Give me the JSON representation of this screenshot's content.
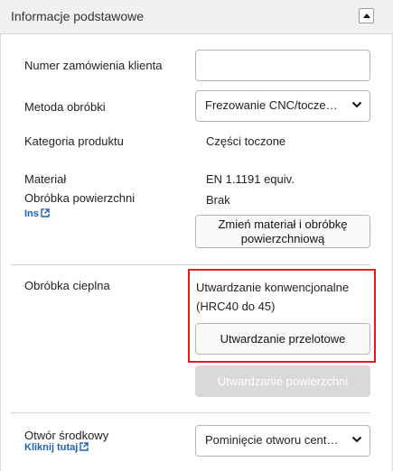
{
  "header": {
    "title": "Informacje podstawowe"
  },
  "fields": {
    "order_number": {
      "label": "Numer zamówienia klienta",
      "value": ""
    },
    "method": {
      "label": "Metoda obróbki",
      "selected": "Frezowanie CNC/toczenie"
    },
    "category": {
      "label": "Kategoria produktu",
      "value": "Części toczone"
    },
    "material": {
      "label": "Materiał",
      "value": "EN 1.1191 equiv."
    },
    "surface": {
      "label": "Obróbka powierzchni",
      "value": "Brak",
      "link": "Ins"
    },
    "change_button": {
      "line1": "Zmień materiał i obróbkę",
      "line2": "powierzchniową"
    },
    "heat": {
      "label": "Obróbka cieplna",
      "desc_line1": "Utwardzanie konwencjonalne",
      "desc_line2": "(HRC40 do 45)",
      "through_button": "Utwardzanie przelotowe",
      "surface_button": "Utwardzanie powierzchni"
    },
    "center_hole": {
      "label": "Otwór środkowy",
      "link": "Kliknij tutaj",
      "selected": "Pominięcie otworu centralnego"
    }
  },
  "colors": {
    "link": "#1d5fb5",
    "highlight": "#e31b1b",
    "disabled_button": "#d9d9d9"
  }
}
